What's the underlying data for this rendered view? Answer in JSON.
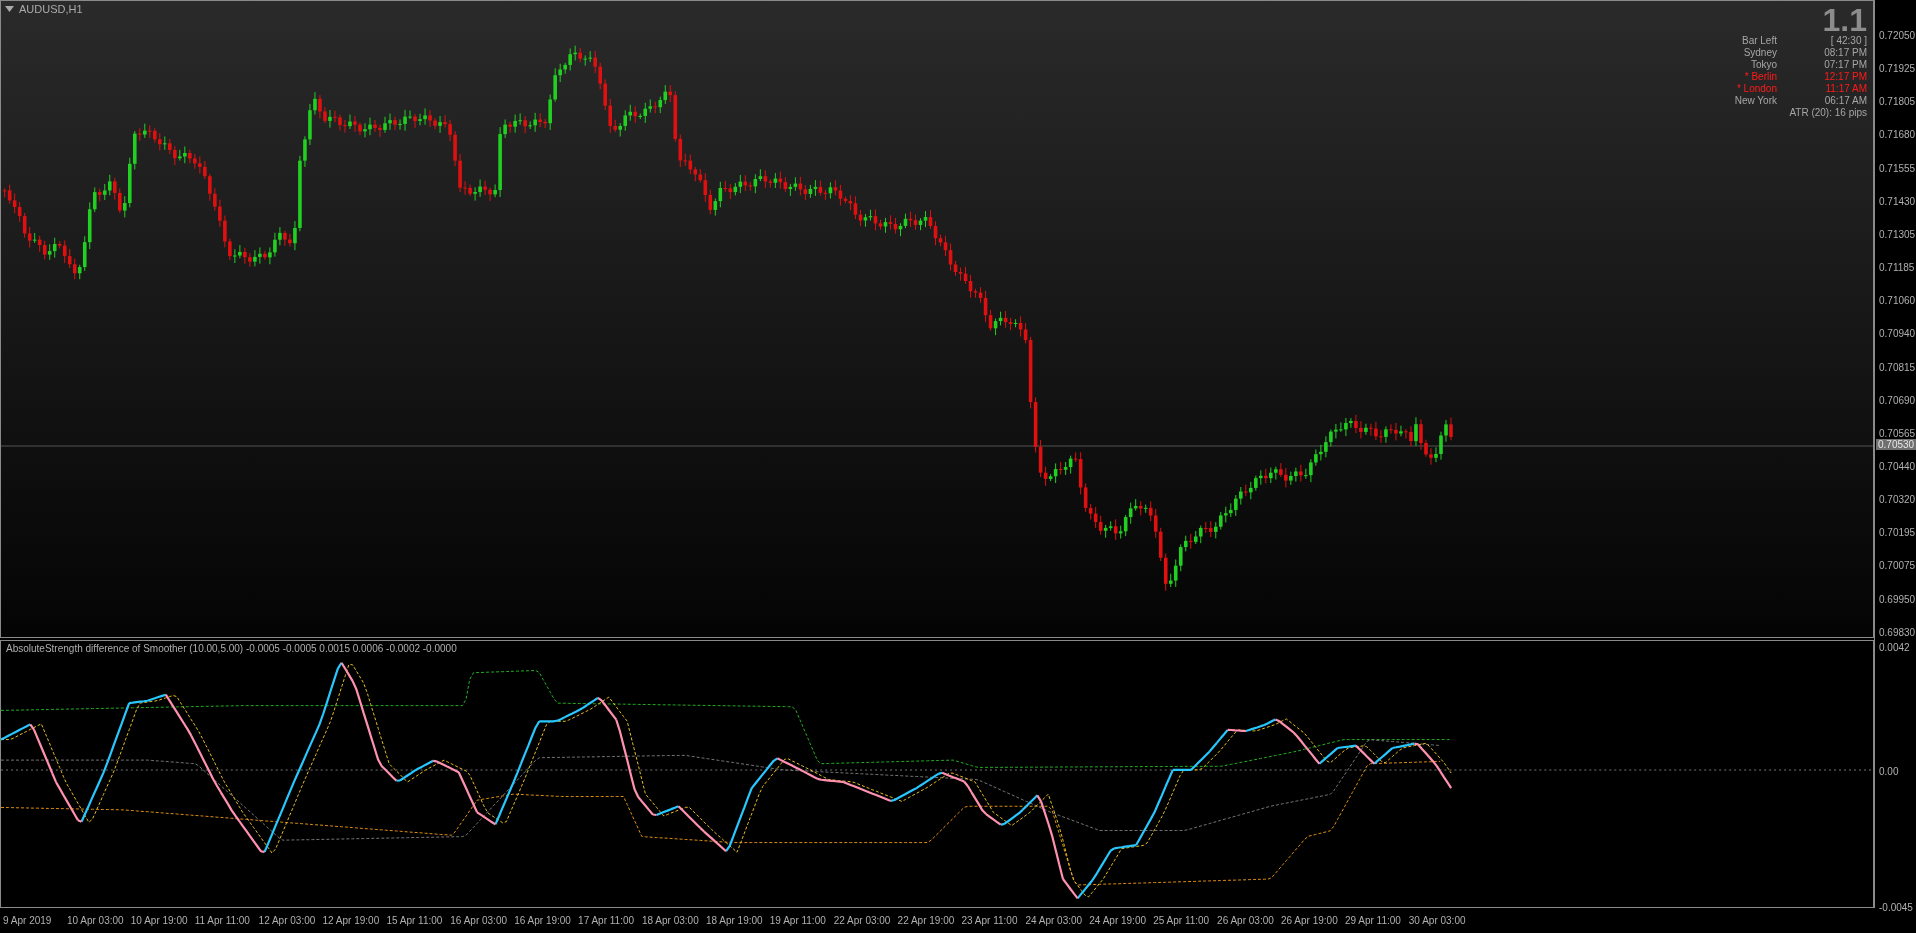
{
  "window": {
    "title": "AUDUSD,H1"
  },
  "info_panel": {
    "headline": "1.1",
    "rows": [
      {
        "label": "Bar Left",
        "value": "[ 42:30 ]",
        "highlighted": false
      },
      {
        "label": "Sydney",
        "value": "08:17 PM",
        "highlighted": false
      },
      {
        "label": "Tokyo",
        "value": "07:17 PM",
        "highlighted": false
      },
      {
        "label": "* Berlin",
        "value": "12:17 PM",
        "highlighted": true
      },
      {
        "label": "* London",
        "value": "11:17 AM",
        "highlighted": true
      },
      {
        "label": "New York",
        "value": "06:17 AM",
        "highlighted": false
      }
    ],
    "atr": "ATR (20): 16 pips"
  },
  "price_axis": {
    "ticks": [
      "0.72050",
      "0.71925",
      "0.71805",
      "0.71680",
      "0.71555",
      "0.71430",
      "0.71305",
      "0.71185",
      "0.71060",
      "0.70940",
      "0.70815",
      "0.70690",
      "0.70565",
      "0.70440",
      "0.70320",
      "0.70195",
      "0.70075",
      "0.69950",
      "0.69830"
    ],
    "current_price": "0.70530"
  },
  "indicator": {
    "header": "AbsoluteStrength difference of Smoother (10.00,5.00) -0.0005 -0.0005 0.0015 0.0006 -0.0002 -0.0000",
    "ticks": [
      "0.0042",
      "0.00",
      "-0.0045"
    ]
  },
  "time_axis": {
    "labels": [
      "9 Apr 2019",
      "10 Apr 03:00",
      "10 Apr 19:00",
      "11 Apr 11:00",
      "12 Apr 03:00",
      "12 Apr 19:00",
      "15 Apr 11:00",
      "16 Apr 03:00",
      "16 Apr 19:00",
      "17 Apr 11:00",
      "18 Apr 03:00",
      "18 Apr 19:00",
      "19 Apr 11:00",
      "22 Apr 03:00",
      "22 Apr 19:00",
      "23 Apr 11:00",
      "24 Apr 03:00",
      "24 Apr 19:00",
      "25 Apr 11:00",
      "26 Apr 03:00",
      "26 Apr 19:00",
      "29 Apr 11:00",
      "30 Apr 03:00"
    ]
  }
}
